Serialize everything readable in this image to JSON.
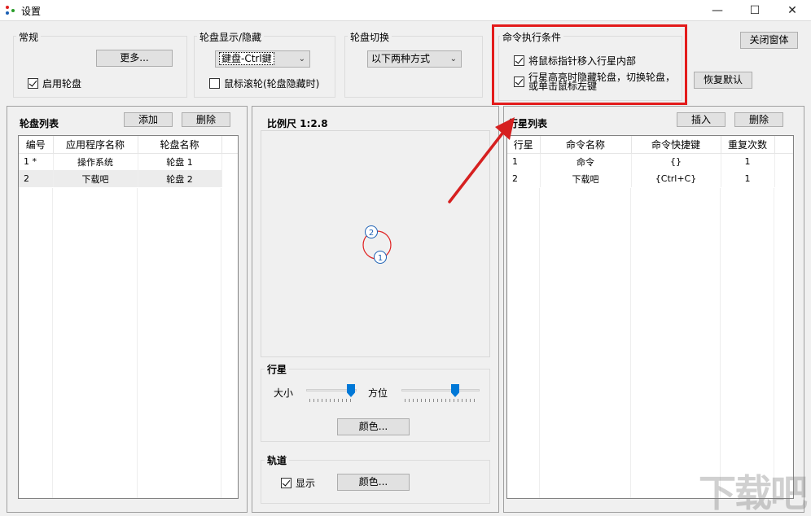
{
  "window": {
    "title": "设置",
    "minimize": "—",
    "maximize": "☐",
    "close": "✕"
  },
  "top": {
    "general": {
      "title": "常规",
      "more_button": "更多...",
      "enable_wheel": "启用轮盘",
      "enable_wheel_checked": true
    },
    "show_hide": {
      "title": "轮盘显示/隐藏",
      "combo_value": "鍵盘-Ctrl鍵",
      "mouse_wheel": "鼠标滚轮(轮盘隐藏时)",
      "mouse_wheel_checked": false
    },
    "switch": {
      "title": "轮盘切换",
      "combo_value": "以下两种方式"
    },
    "exec_cond": {
      "title": "命令执行条件",
      "opt1": "将鼠标指针移入行星内部",
      "opt1_checked": true,
      "opt2_line1": "行星高亮时隐藏轮盘，切换轮盘，",
      "opt2_line2": "或单击鼠标左键",
      "opt2_checked": true,
      "restore_button": "恢复默认"
    },
    "close_button": "关闭窗体"
  },
  "wheel_list": {
    "title": "轮盘列表",
    "add_button": "添加",
    "delete_button": "删除",
    "columns": [
      "编号",
      "应用程序名称",
      "轮盘名称"
    ],
    "rows": [
      [
        "1 *",
        "操作系统",
        "轮盘 1"
      ],
      [
        "2",
        "下载吧",
        "轮盘 2"
      ]
    ]
  },
  "preview": {
    "scale_label": "比例尺 1:2.8",
    "node1": "1",
    "node2": "2",
    "planet": {
      "title": "行星",
      "size_label": "大小",
      "size_value": 0.87,
      "direction_label": "方位",
      "direction_value": 0.72,
      "color_button": "颜色..."
    },
    "track": {
      "title": "轨道",
      "show_label": "显示",
      "show_checked": true,
      "color_button": "颜色..."
    }
  },
  "planet_list": {
    "title": "行星列表",
    "insert_button": "插入",
    "delete_button": "删除",
    "columns": [
      "行星",
      "命令名称",
      "命令快捷键",
      "重复次数"
    ],
    "rows": [
      [
        "1",
        "命令",
        "{}",
        "1"
      ],
      [
        "2",
        "下载吧",
        "{Ctrl+C}",
        "1"
      ]
    ]
  },
  "watermark": "下载吧",
  "colors": {
    "highlight": "#e31b1b",
    "arrow": "#d62020",
    "slider": "#0078d7",
    "orbit": "#e02020",
    "node": "#1a5fb4"
  }
}
